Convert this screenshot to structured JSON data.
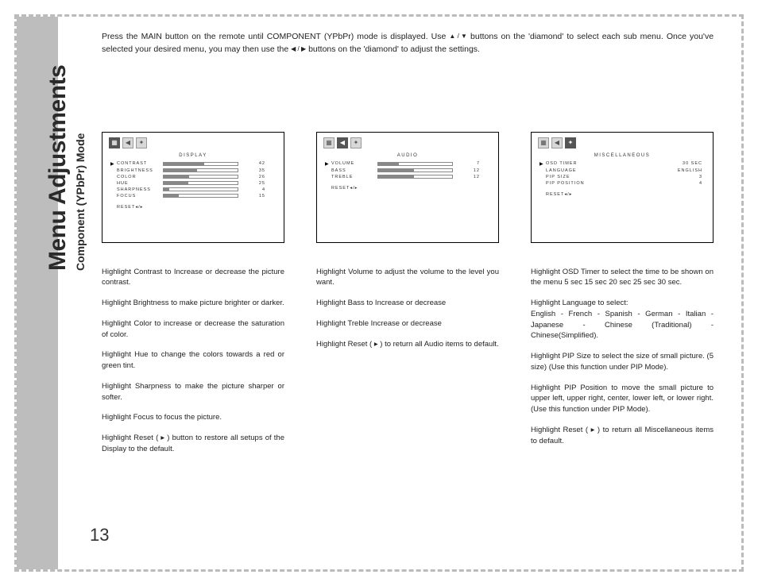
{
  "sidebar": {
    "title": "Menu Adjustments",
    "subtitle": "Component (YPbPr) Mode"
  },
  "page_number": "13",
  "intro": {
    "line1_a": "Press the MAIN button on the remote until COMPONENT (YPbPr) mode is displayed. Use",
    "line1_b": "buttons on the 'diamond' to select each",
    "line2_a": "sub menu. Once you've selected your desired menu, you may then use the",
    "line2_b": "buttons on the 'diamond' to adjust the settings."
  },
  "panels": {
    "display": {
      "title": "DISPLAY",
      "rows": [
        {
          "label": "CONTRAST",
          "value": "42",
          "pct": 55
        },
        {
          "label": "BRIGHTNESS",
          "value": "35",
          "pct": 45
        },
        {
          "label": "COLOR",
          "value": "26",
          "pct": 34
        },
        {
          "label": "HUE",
          "value": "25",
          "pct": 33
        },
        {
          "label": "SHARPNESS",
          "value": "4",
          "pct": 8
        },
        {
          "label": "FOCUS",
          "value": "15",
          "pct": 20
        }
      ],
      "reset": "RESET◂/▸"
    },
    "audio": {
      "title": "AUDIO",
      "rows": [
        {
          "label": "VOLUME",
          "value": "7",
          "pct": 28
        },
        {
          "label": "BASS",
          "value": "12",
          "pct": 48
        },
        {
          "label": "TREBLE",
          "value": "12",
          "pct": 48
        }
      ],
      "reset": "RESET◂/▸"
    },
    "misc": {
      "title": "MISCELLANEOUS",
      "rows": [
        {
          "label": "OSD TIMER",
          "value": "30 SEC"
        },
        {
          "label": "LANGUAGE",
          "value": "ENGLISH"
        },
        {
          "label": "PIP SIZE",
          "value": "3"
        },
        {
          "label": "PIP POSITION",
          "value": "4"
        }
      ],
      "reset": "RESET◂/▸"
    }
  },
  "desc": {
    "display": [
      "Highlight Contrast to Increase or decrease the picture contrast.",
      "Highlight Brightness to make picture brighter or darker.",
      "Highlight Color to increase or decrease the saturation of color.",
      "Highlight Hue to change the colors towards a red or green tint.",
      "Highlight Sharpness to make the picture sharper or softer.",
      "Highlight Focus to focus the picture.",
      "Highlight Reset ( ▸ ) button to restore all setups of the Display to the default."
    ],
    "audio": [
      "Highlight Volume to adjust the volume to the level you want.",
      "Highlight Bass to Increase or decrease",
      "Highlight Treble Increase or decrease",
      "Highlight Reset ( ▸ ) to return all Audio items to default."
    ],
    "misc": [
      "Highlight OSD Timer to select the time to be shown on the menu 5 sec 15 sec 20 sec 25 sec 30 sec.",
      "Highlight Language to select:\nEnglish - French - Spanish - German - Italian - Japanese - Chinese (Traditional) - Chinese(Simplified).",
      "Highlight PIP Size to select the size of small picture. (5 size) (Use this function under PIP Mode).",
      "Highlight PIP Position to move the small picture to upper left, upper right, center, lower left, or lower right.(Use this function under PIP Mode).",
      "Highlight Reset ( ▸ ) to return all Miscellaneous items to default."
    ]
  }
}
